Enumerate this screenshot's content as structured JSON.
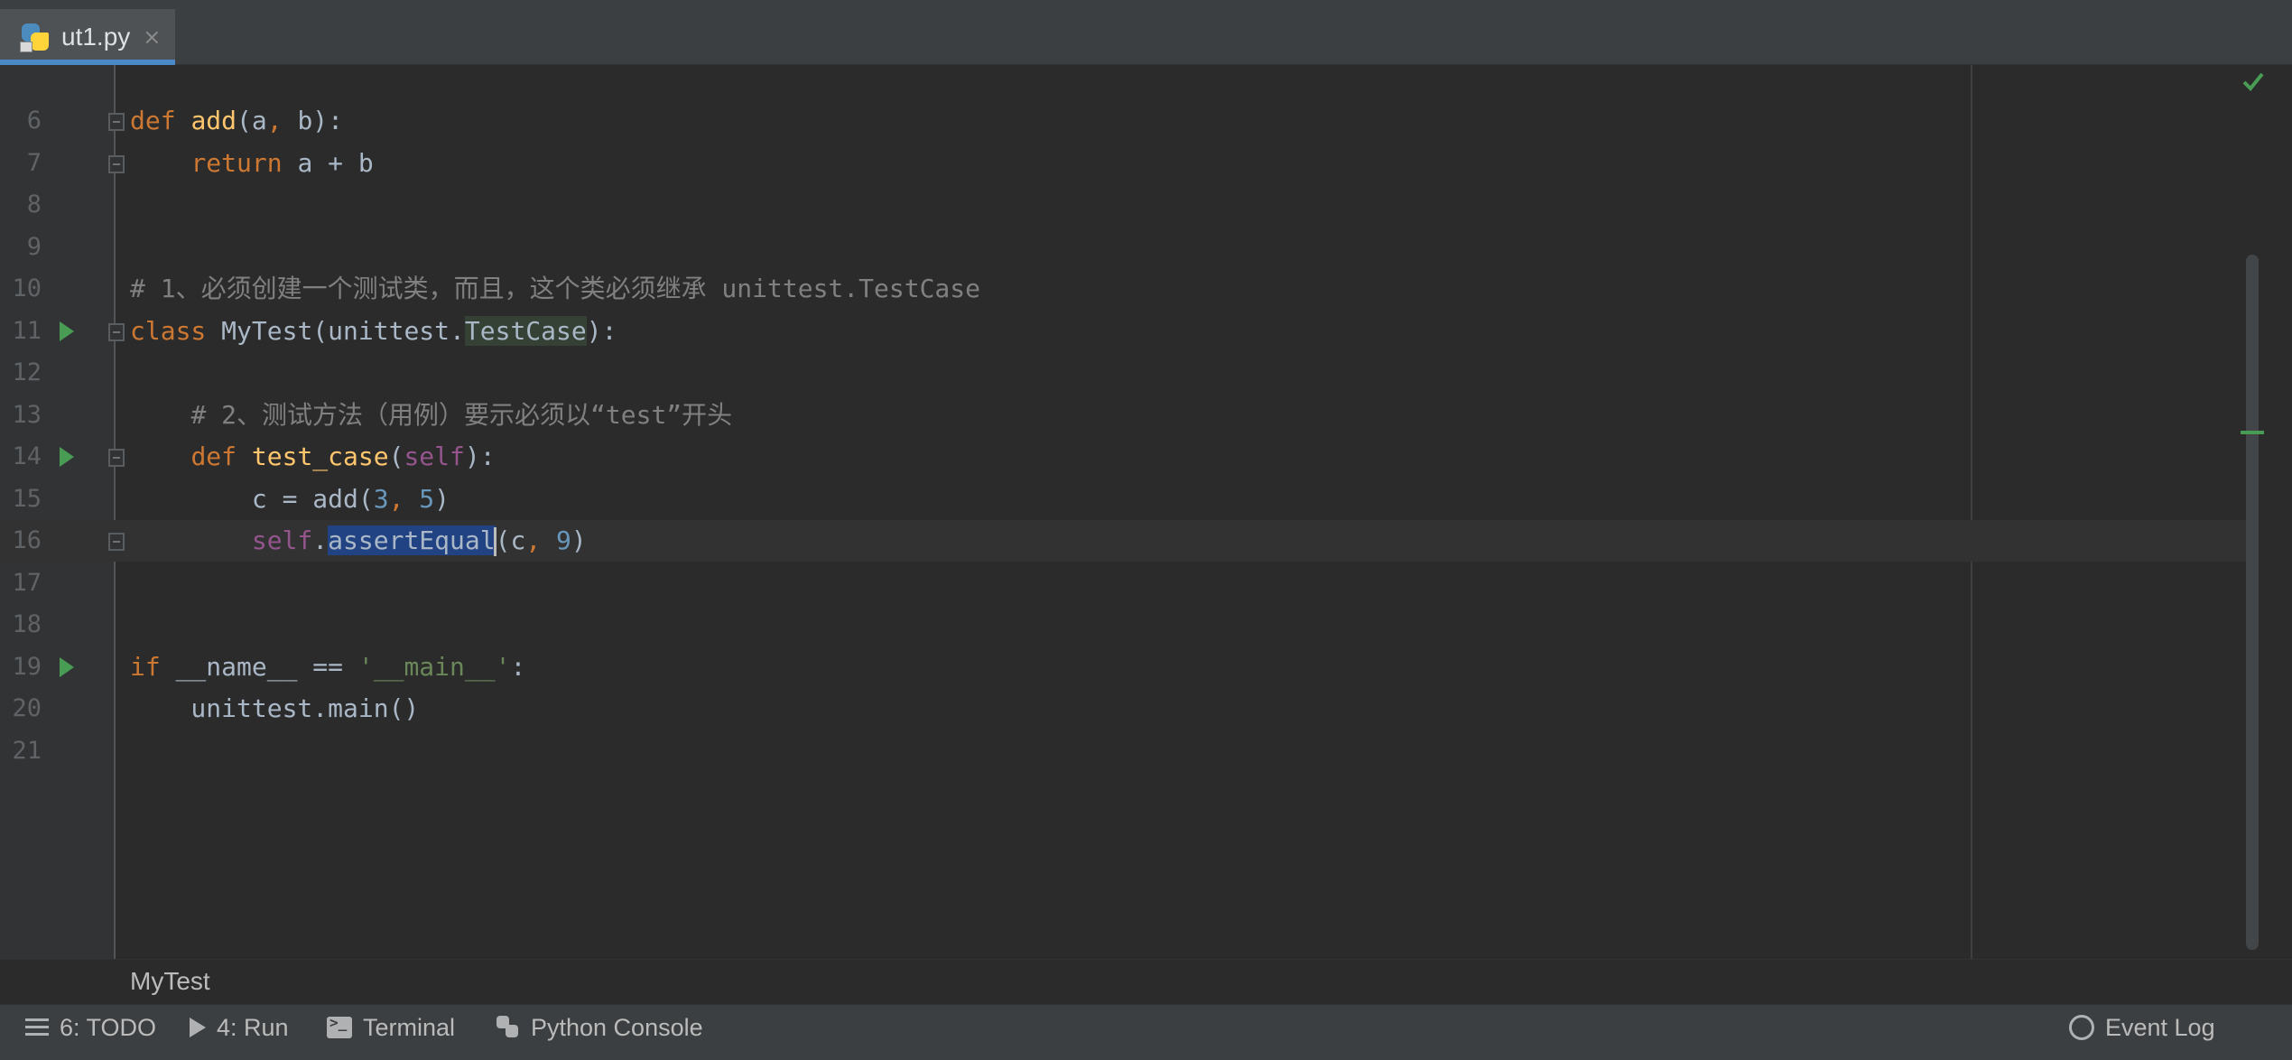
{
  "tab": {
    "filename": "ut1.py",
    "close": "×"
  },
  "editor": {
    "lines": [
      {
        "n": "6",
        "run": false,
        "fold": true,
        "current": false,
        "segments": [
          [
            "kw",
            "def "
          ],
          [
            "fn",
            "add"
          ],
          [
            "",
            "(a"
          ],
          [
            "kw",
            ", "
          ],
          [
            "",
            "b):"
          ]
        ]
      },
      {
        "n": "7",
        "run": false,
        "fold": true,
        "current": false,
        "segments": [
          [
            "",
            "    "
          ],
          [
            "kw",
            "return "
          ],
          [
            "",
            "a + b"
          ]
        ]
      },
      {
        "n": "8",
        "run": false,
        "fold": false,
        "current": false,
        "segments": []
      },
      {
        "n": "9",
        "run": false,
        "fold": false,
        "current": false,
        "segments": []
      },
      {
        "n": "10",
        "run": false,
        "fold": false,
        "current": false,
        "segments": [
          [
            "cmt",
            "# 1、必须创建一个测试类，而且，这个类必须继承 unittest.TestCase"
          ]
        ]
      },
      {
        "n": "11",
        "run": true,
        "fold": true,
        "current": false,
        "segments": [
          [
            "kw",
            "class "
          ],
          [
            "",
            "MyTest(unittest."
          ],
          [
            "hl-type",
            "TestCase"
          ],
          [
            "",
            "):"
          ]
        ]
      },
      {
        "n": "12",
        "run": false,
        "fold": false,
        "current": false,
        "segments": []
      },
      {
        "n": "13",
        "run": false,
        "fold": false,
        "current": false,
        "segments": [
          [
            "",
            "    "
          ],
          [
            "cmt",
            "# 2、测试方法（用例）要示必须以“test”开头"
          ]
        ]
      },
      {
        "n": "14",
        "run": true,
        "fold": true,
        "current": false,
        "segments": [
          [
            "",
            "    "
          ],
          [
            "kw",
            "def "
          ],
          [
            "fn",
            "test_case"
          ],
          [
            "",
            "("
          ],
          [
            "self",
            "self"
          ],
          [
            "",
            "):"
          ]
        ]
      },
      {
        "n": "15",
        "run": false,
        "fold": false,
        "current": false,
        "segments": [
          [
            "",
            "        c = add("
          ],
          [
            "num",
            "3"
          ],
          [
            "kw",
            ", "
          ],
          [
            "num",
            "5"
          ],
          [
            "",
            ")"
          ]
        ]
      },
      {
        "n": "16",
        "run": false,
        "fold": true,
        "current": true,
        "segments": [
          [
            "",
            "        "
          ],
          [
            "self",
            "self"
          ],
          [
            "",
            "."
          ],
          [
            "sel",
            "assertEqual"
          ],
          [
            "caret",
            ""
          ],
          [
            "",
            "(c"
          ],
          [
            "kw",
            ", "
          ],
          [
            "num",
            "9"
          ],
          [
            "",
            ")"
          ]
        ]
      },
      {
        "n": "17",
        "run": false,
        "fold": false,
        "current": false,
        "segments": []
      },
      {
        "n": "18",
        "run": false,
        "fold": false,
        "current": false,
        "segments": []
      },
      {
        "n": "19",
        "run": true,
        "fold": false,
        "current": false,
        "segments": [
          [
            "kw",
            "if "
          ],
          [
            "",
            "__name__ == "
          ],
          [
            "str",
            "'__main__'"
          ],
          [
            "",
            ":"
          ]
        ]
      },
      {
        "n": "20",
        "run": false,
        "fold": false,
        "current": false,
        "segments": [
          [
            "",
            "    unittest.main()"
          ]
        ]
      },
      {
        "n": "21",
        "run": false,
        "fold": false,
        "current": false,
        "segments": []
      }
    ]
  },
  "breadcrumb": {
    "class_name": "MyTest"
  },
  "toolwindows": {
    "todo": "6: TODO",
    "run": "4: Run",
    "terminal": "Terminal",
    "python_console": "Python Console",
    "event_log": "Event Log"
  },
  "colors": {
    "keyword": "#cc7832",
    "function": "#ffc66d",
    "number": "#6897bb",
    "string": "#6a8759",
    "self": "#94558d",
    "comment": "#808080",
    "selection": "#214283",
    "run_icon": "#499c54"
  },
  "icons": {
    "file": "python-file-icon",
    "run": "run-gutter-icon",
    "fold": "fold-icon",
    "status": "check-icon"
  }
}
